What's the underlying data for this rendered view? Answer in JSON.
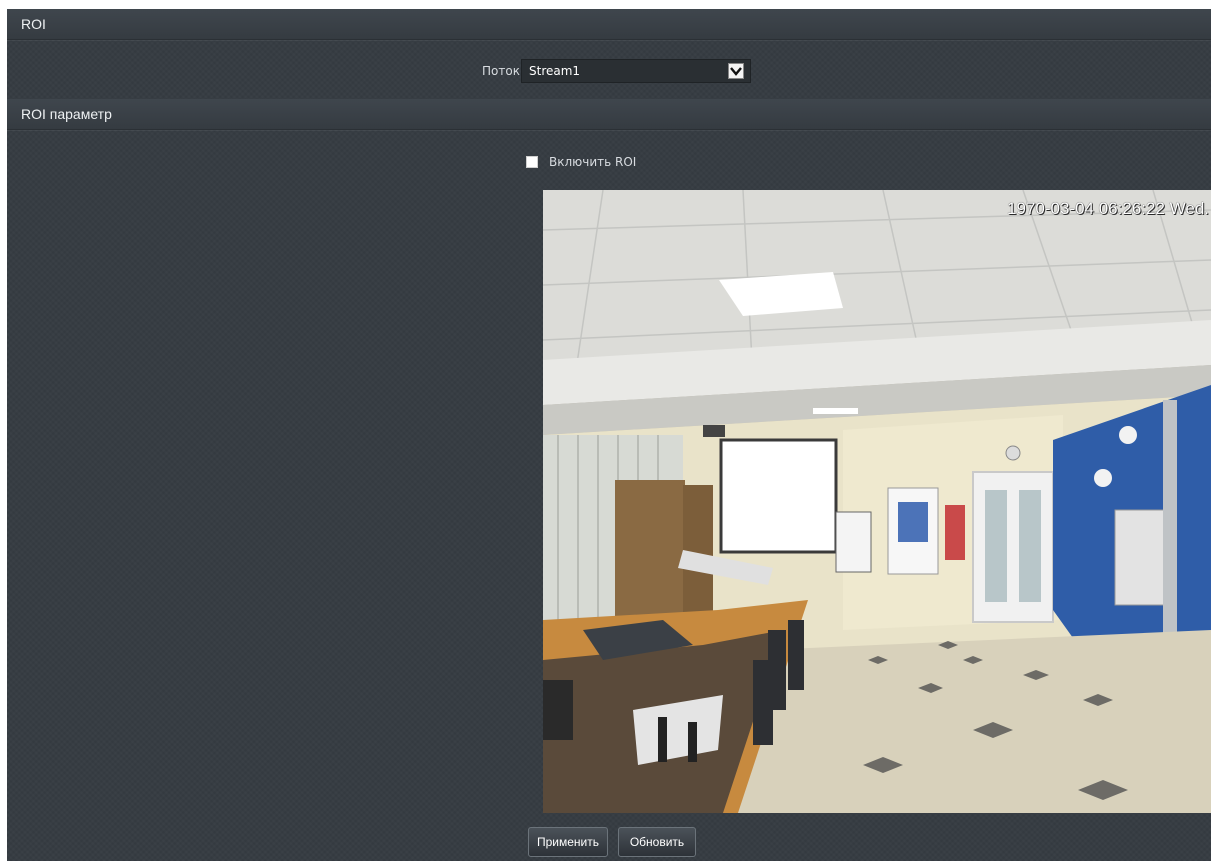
{
  "header": {
    "title": "ROI"
  },
  "stream": {
    "label": "Поток:",
    "selected": "Stream1"
  },
  "params_section": {
    "title": "ROI параметр"
  },
  "roi": {
    "enable_label": "Включить ROI",
    "enabled": false
  },
  "video": {
    "timestamp": "1970-03-04 06:26:22 Wed."
  },
  "buttons": {
    "apply": "Применить",
    "refresh": "Обновить"
  },
  "colors": {
    "background": "#363c42",
    "header": "#3f464d",
    "text": "#e6e9ec"
  }
}
